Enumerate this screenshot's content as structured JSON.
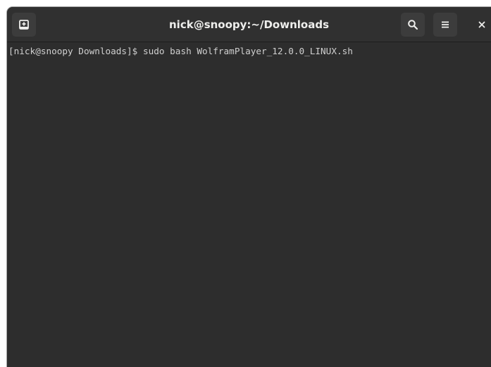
{
  "window": {
    "title": "nick@snoopy:~/Downloads"
  },
  "header": {
    "new_tab_icon": "new-tab-icon",
    "search_icon": "search-icon",
    "menu_icon": "hamburger-menu-icon",
    "close_icon": "close-icon"
  },
  "terminal": {
    "prompt": "[nick@snoopy Downloads]$ ",
    "command": "sudo bash WolframPlayer_12.0.0_LINUX.sh"
  },
  "colors": {
    "background": "#2d2d2d",
    "headerbar": "#303030",
    "text": "#d0d0d0",
    "title": "#eeeeec"
  }
}
